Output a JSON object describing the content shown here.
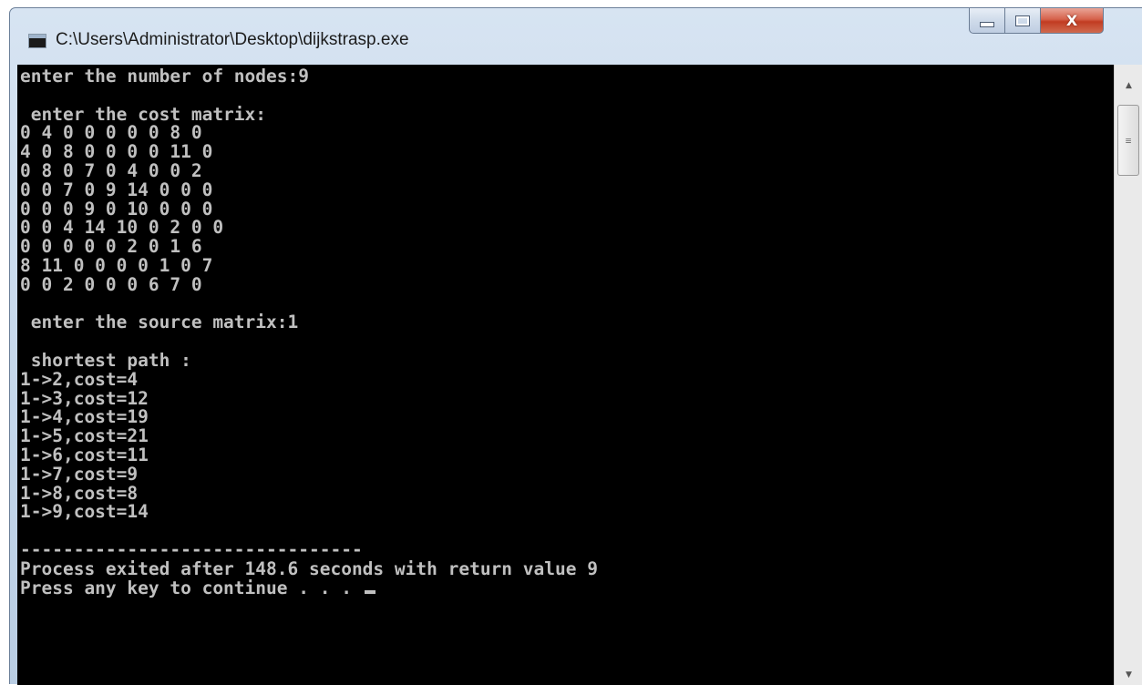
{
  "window": {
    "title": "C:\\Users\\Administrator\\Desktop\\dijkstrasp.exe",
    "close_glyph": "X",
    "icons": {
      "app": "console-app-icon",
      "minimize": "minimize-icon",
      "maximize": "maximize-icon",
      "close": "close-icon"
    },
    "colors": {
      "console_background": "#000000",
      "console_text": "#c0c0c0",
      "close_button": "#c13c22"
    }
  },
  "console": {
    "lines": [
      "enter the number of nodes:9",
      "",
      " enter the cost matrix:",
      "0 4 0 0 0 0 0 8 0",
      "4 0 8 0 0 0 0 11 0",
      "0 8 0 7 0 4 0 0 2",
      "0 0 7 0 9 14 0 0 0",
      "0 0 0 9 0 10 0 0 0",
      "0 0 4 14 10 0 2 0 0",
      "0 0 0 0 0 2 0 1 6",
      "8 11 0 0 0 0 1 0 7",
      "0 0 2 0 0 0 6 7 0",
      "",
      " enter the source matrix:1",
      "",
      " shortest path :",
      "1->2,cost=4",
      "1->3,cost=12",
      "1->4,cost=19",
      "1->5,cost=21",
      "1->6,cost=11",
      "1->7,cost=9",
      "1->8,cost=8",
      "1->9,cost=14",
      "",
      "--------------------------------",
      "Process exited after 148.6 seconds with return value 9",
      "Press any key to continue . . . "
    ]
  },
  "scrollbar": {
    "up_icon": "scroll-up-arrow-icon",
    "down_icon": "scroll-down-arrow-icon"
  }
}
